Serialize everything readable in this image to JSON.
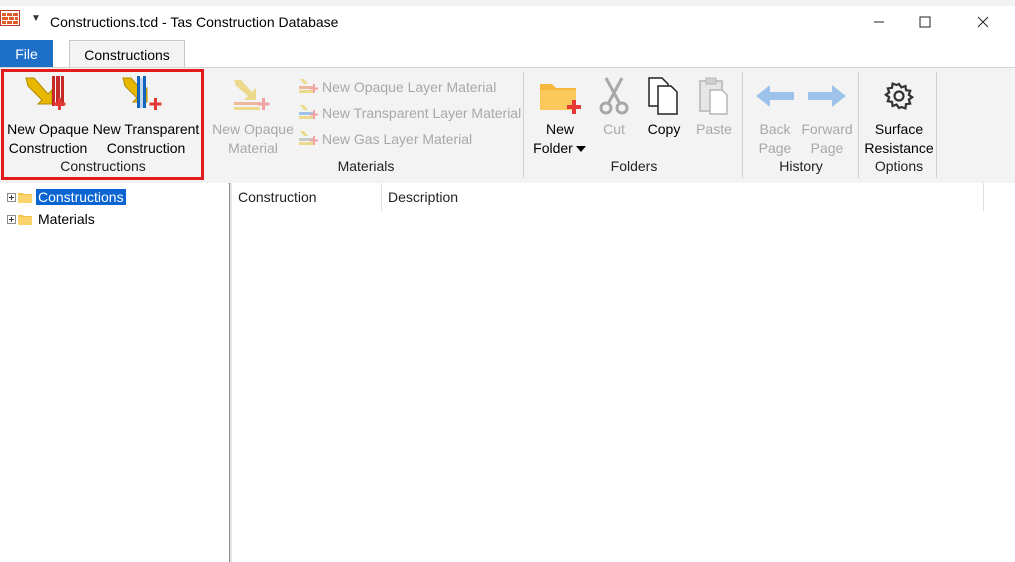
{
  "window": {
    "title": "Constructions.tcd - Tas Construction Database",
    "qat_symbol": "▼",
    "minimize_symbol": "—",
    "maximize_symbol": "☐",
    "close_symbol": "✕"
  },
  "tabs": {
    "file": "File",
    "constructions": "Constructions"
  },
  "ribbon": {
    "constructions_group": {
      "new_opaque_line1": "New Opaque",
      "new_opaque_line2": "Construction",
      "new_transparent_line1": "New Transparent",
      "new_transparent_line2": "Construction",
      "label": "Constructions"
    },
    "materials_group": {
      "new_opaque_material_line1": "New Opaque",
      "new_opaque_material_line2": "Material",
      "new_opaque_layer": "New Opaque Layer Material",
      "new_transparent_layer": "New Transparent Layer Material",
      "new_gas_layer": "New Gas Layer Material",
      "label": "Materials"
    },
    "folders_group": {
      "new_folder_line1": "New",
      "new_folder_line2": "Folder",
      "cut": "Cut",
      "copy": "Copy",
      "paste": "Paste",
      "label": "Folders"
    },
    "history_group": {
      "back_line1": "Back",
      "back_line2": "Page",
      "forward_line1": "Forward",
      "forward_line2": "Page",
      "label": "History"
    },
    "options_group": {
      "surface_line1": "Surface",
      "surface_line2": "Resistance",
      "label": "Options"
    }
  },
  "tree": {
    "items": [
      "Constructions",
      "Materials"
    ]
  },
  "list": {
    "columns": [
      "Construction",
      "Description"
    ]
  },
  "colors": {
    "accent": "#1e6fc8",
    "selection": "#0a64d2",
    "highlight_box": "#e21c1c"
  }
}
